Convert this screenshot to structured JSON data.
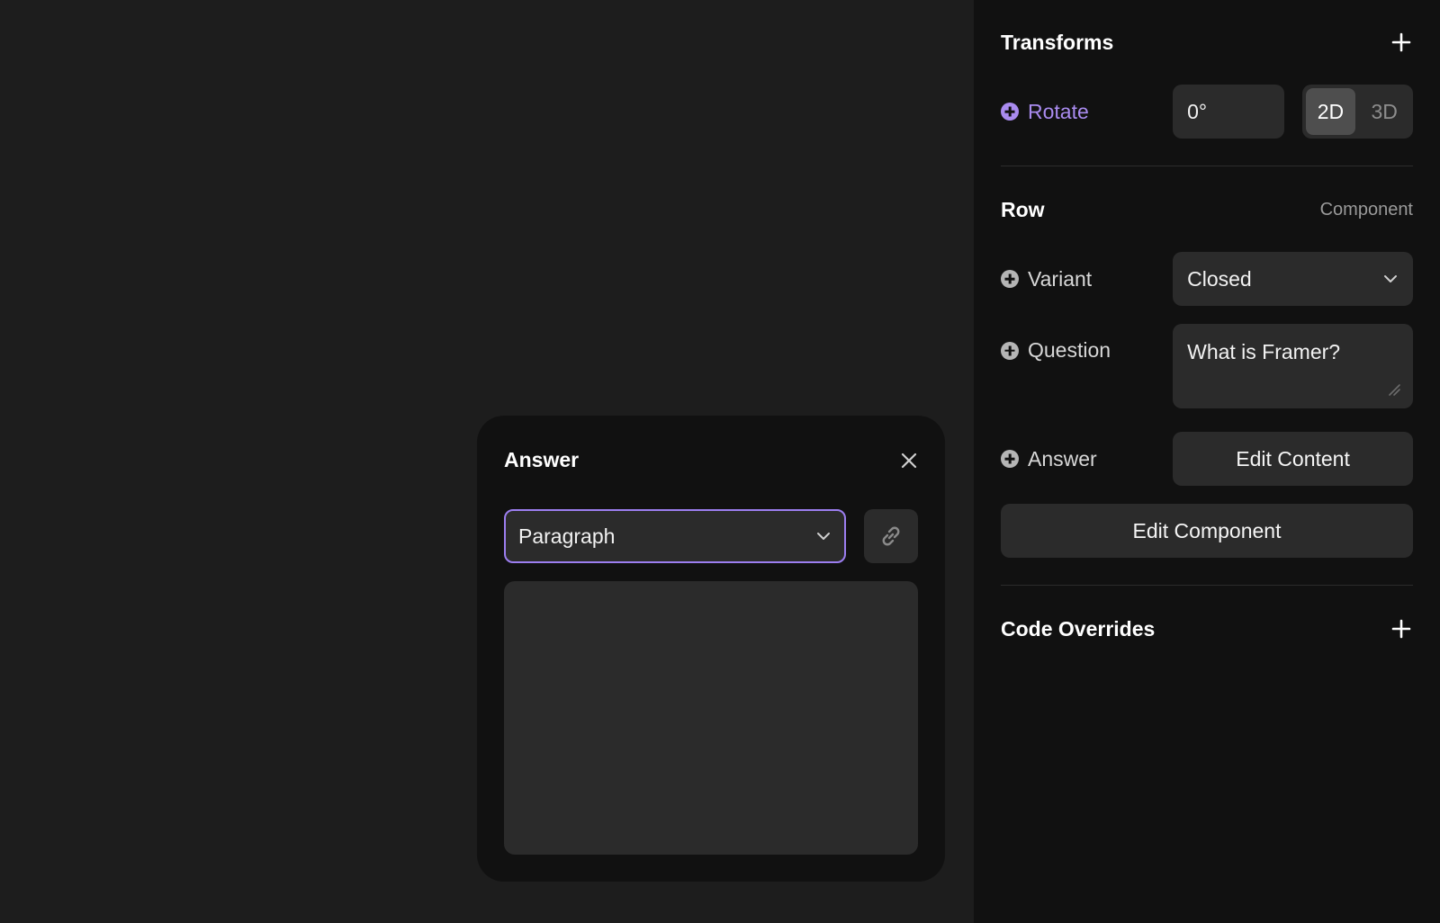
{
  "panel": {
    "transforms": {
      "title": "Transforms",
      "rotate": {
        "label": "Rotate",
        "value": "0°",
        "modes": [
          "2D",
          "3D"
        ],
        "active_mode": "2D"
      }
    },
    "row": {
      "title": "Row",
      "kind": "Component",
      "variant": {
        "label": "Variant",
        "value": "Closed"
      },
      "question": {
        "label": "Question",
        "value": "What is Framer?"
      },
      "answer": {
        "label": "Answer",
        "button": "Edit Content"
      },
      "edit_component": "Edit Component"
    },
    "code_overrides": {
      "title": "Code Overrides"
    }
  },
  "popover": {
    "title": "Answer",
    "text_style": "Paragraph",
    "content": ""
  },
  "colors": {
    "accent": "#a98bef",
    "panel_bg": "#111111",
    "canvas_bg": "#1d1d1d",
    "field_bg": "#2b2b2b"
  },
  "icons": [
    "plus-icon",
    "circle-plus-icon",
    "chevron-down-icon",
    "close-icon",
    "link-icon",
    "resize-handle-icon"
  ]
}
